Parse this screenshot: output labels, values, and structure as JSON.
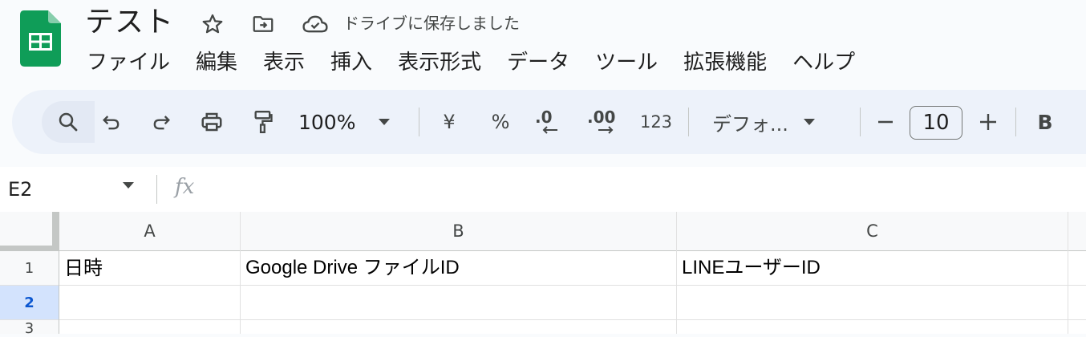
{
  "doc": {
    "title": "テスト",
    "save_status": "ドライブに保存しました"
  },
  "menu": [
    "ファイル",
    "編集",
    "表示",
    "挿入",
    "表示形式",
    "データ",
    "ツール",
    "拡張機能",
    "ヘルプ"
  ],
  "toolbar": {
    "zoom": "100%",
    "currency": "¥",
    "percent": "%",
    "decrease_decimal": ".0",
    "increase_decimal": ".00",
    "number_format": "123",
    "font": "デフォ...",
    "font_size": "10",
    "bold": "B"
  },
  "formula_bar": {
    "cell_ref": "E2",
    "fx": "fx",
    "formula": ""
  },
  "grid": {
    "columns": [
      "A",
      "B",
      "C"
    ],
    "rows": [
      "1",
      "2",
      "3"
    ],
    "selected_row": "2",
    "cells": {
      "A1": "日時",
      "B1": "Google Drive ファイルID",
      "C1": "LINEユーザーID"
    }
  },
  "colors": {
    "brand_green": "#0f9d58",
    "toolbar_bg": "#edf2fa",
    "selected_row_bg": "#d3e3fd",
    "selected_row_text": "#0b57d0"
  }
}
